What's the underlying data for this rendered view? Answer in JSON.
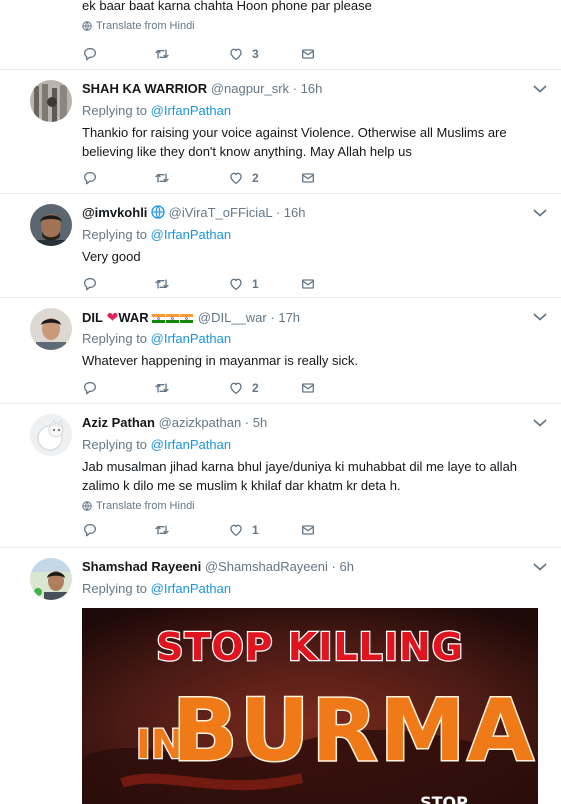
{
  "top_tweet": {
    "text": "ek baar baat karna chahta Hoon phone par please",
    "translate": "Translate from Hindi",
    "like_count": "3"
  },
  "tweets": [
    {
      "name": "SHAH KA WARRIOR",
      "handle": "@nagpur_srk",
      "time": "16h",
      "replying_prefix": "Replying to",
      "replying_to": "@IrfanPathan",
      "text": "Thankio for raising your voice against Violence. Otherwise all Muslims are believing like they don't know anything. May Allah help us",
      "like_count": "2"
    },
    {
      "name": "@imvkohli",
      "handle": "@iViraT_oFFiciaL",
      "time": "16h",
      "replying_prefix": "Replying to",
      "replying_to": "@IrfanPathan",
      "text": "Very good",
      "like_count": "1"
    },
    {
      "name_part1": "DIL",
      "name_part2": "WAR",
      "handle": "@DIL__war",
      "time": "17h",
      "replying_prefix": "Replying to",
      "replying_to": "@IrfanPathan",
      "text": "Whatever happening in mayanmar is really sick.",
      "like_count": "2"
    },
    {
      "name": "Aziz Pathan",
      "handle": "@azizkpathan",
      "time": "5h",
      "replying_prefix": "Replying to",
      "replying_to": "@IrfanPathan",
      "text": "Jab musalman jihad karna bhul jaye/duniya ki muhabbat dil me laye to allah zalimo k dilo me se muslim k khilaf dar khatm kr deta h.",
      "translate": "Translate from Hindi",
      "like_count": "1"
    },
    {
      "name": "Shamshad Rayeeni",
      "handle": "@ShamshadRayeeni",
      "time": "6h",
      "replying_prefix": "Replying to",
      "replying_to": "@IrfanPathan"
    }
  ],
  "poster": {
    "line1": "STOP KILLING",
    "line2_prefix": "IN",
    "line2_main": "BURMA",
    "footer": "STOP"
  },
  "colors": {
    "link": "#1b95e0",
    "muted": "#657786",
    "heart": "#e0245e",
    "poster_red": "#e0141e",
    "poster_orange": "#f07a18"
  },
  "icons": [
    "reply-icon",
    "retweet-icon",
    "like-icon",
    "message-icon",
    "globe-icon",
    "chevron-down-icon"
  ]
}
